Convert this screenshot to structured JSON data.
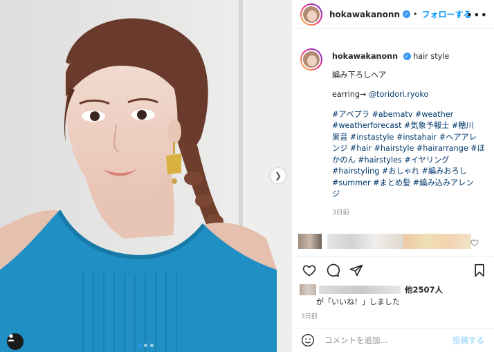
{
  "header": {
    "username": "hokawakanonn",
    "follow_label": "フォローする",
    "more_icon": "•••"
  },
  "caption": {
    "username": "hokawakanonn",
    "title": "hair style",
    "lines": [
      "編み下ろしヘア",
      "",
      "earring→ @toridori.ryoko",
      "",
      "#アベプラ #abematv #weather",
      "#weatherforecast #気象予報士 #穂川",
      "果音 #instastyle #instahair #ヘアアレ",
      "ンジ #hair #hairstyle #hairarrange #ほ",
      "かのん #hairstyles #イヤリング",
      "#hairstyling #おしゃれ #編みおろし",
      "#summer #まとめ髪 #編み込みアレン",
      "ジ"
    ],
    "time_ago": "3日前"
  },
  "likes": {
    "count_text": "他2507人",
    "liked_text": "が「いいね！」しました"
  },
  "post_date": "3日前",
  "comment_box": {
    "placeholder": "コメントを追加...",
    "post_label": "投稿する"
  },
  "colors": {
    "accent": "#0095f6",
    "verified": "#3897f0",
    "hashtag": "#00376b",
    "top_dress": "#1f8fc4"
  },
  "icons": [
    "heart-icon",
    "comment-icon",
    "share-icon",
    "bookmark-icon",
    "smile-icon",
    "chevron-right-icon",
    "user-tag-icon",
    "verified-icon"
  ]
}
